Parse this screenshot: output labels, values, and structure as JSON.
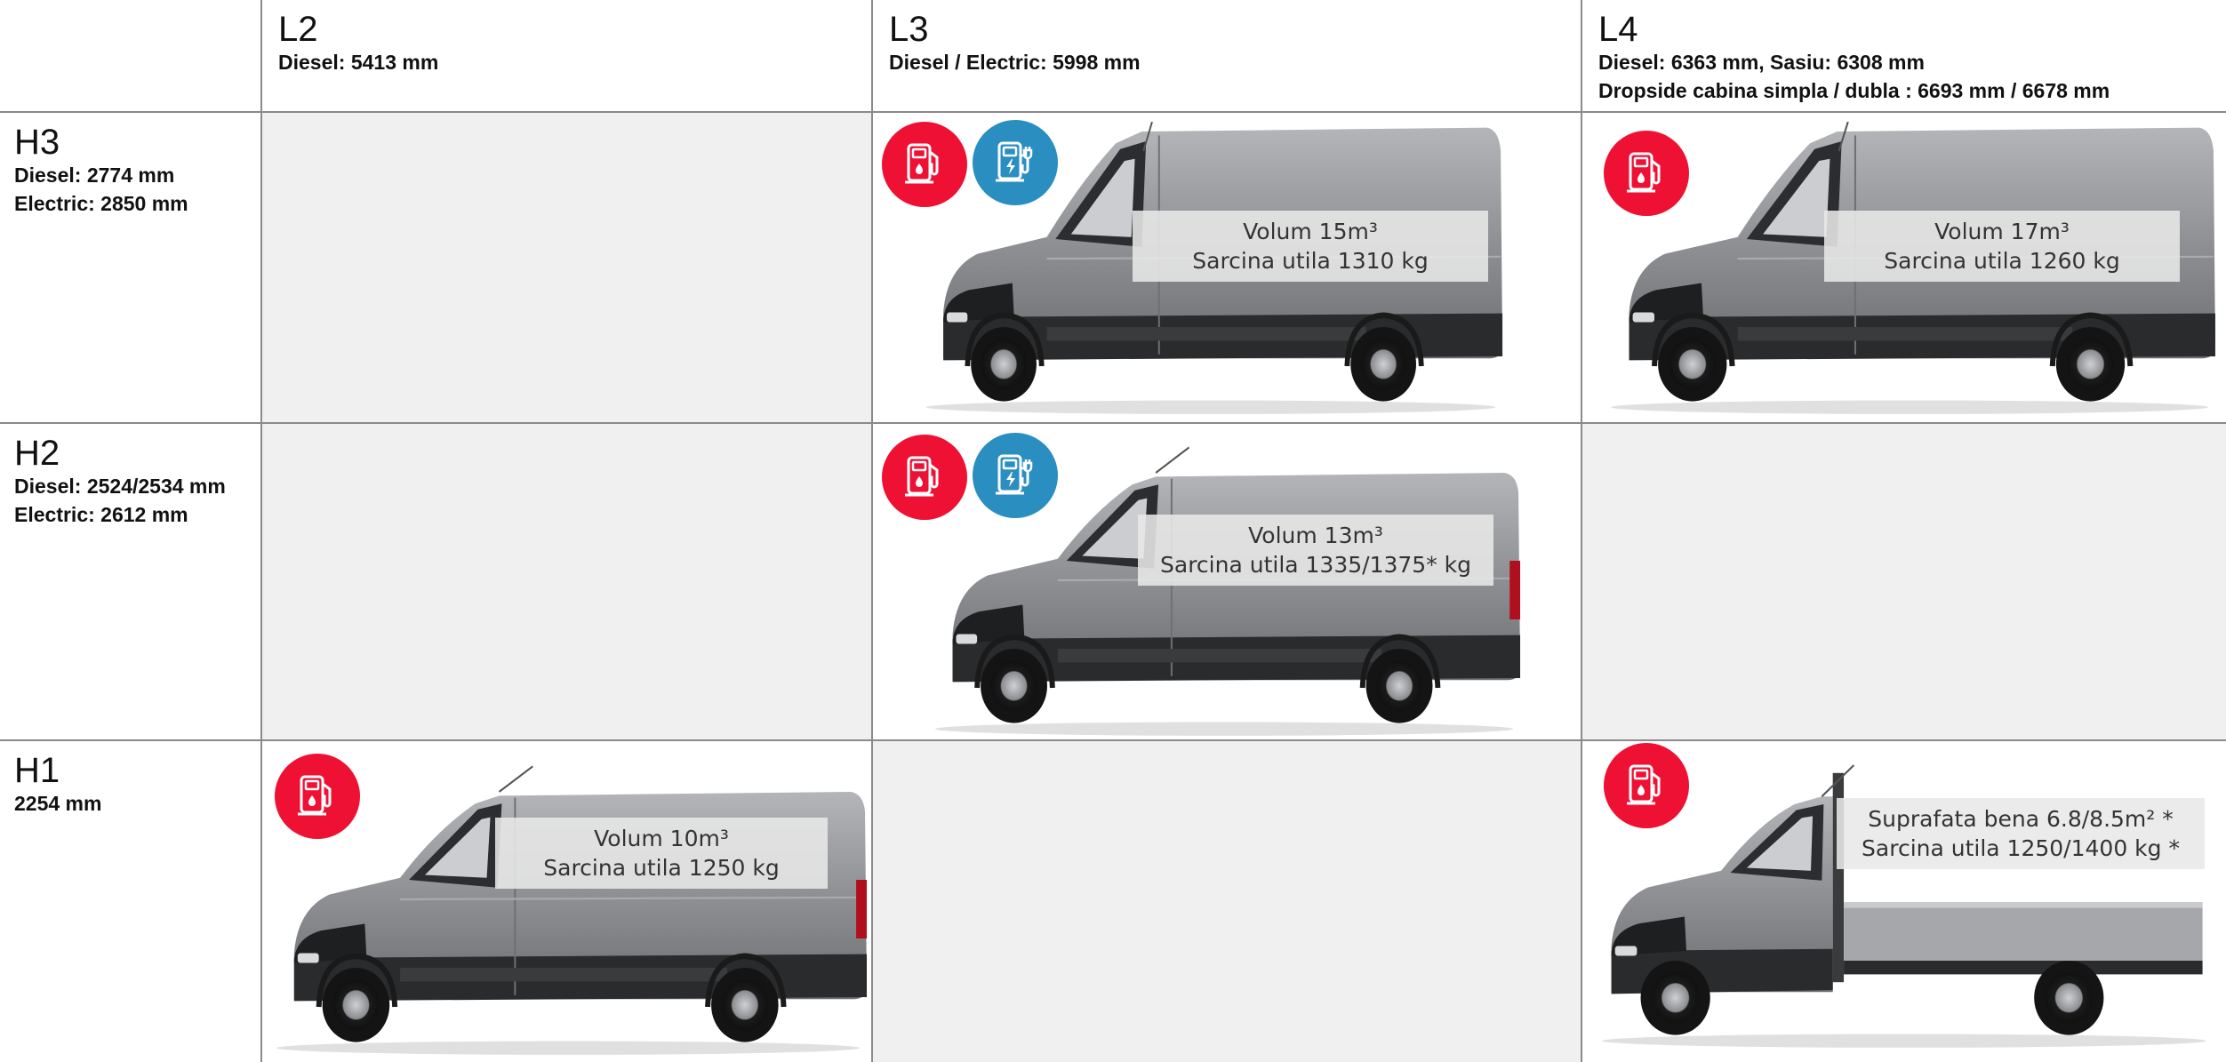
{
  "columns": [
    {
      "title": "L2",
      "lines": [
        "Diesel: 5413 mm"
      ]
    },
    {
      "title": "L3",
      "lines": [
        "Diesel / Electric: 5998 mm"
      ]
    },
    {
      "title": "L4",
      "lines": [
        "Diesel: 6363 mm, Sasiu: 6308 mm",
        "Dropside cabina simpla / dubla : 6693 mm / 6678 mm"
      ]
    }
  ],
  "rows": [
    {
      "title": "H3",
      "lines": [
        "Diesel: 2774 mm",
        "Electric: 2850 mm"
      ]
    },
    {
      "title": "H2",
      "lines": [
        "Diesel: 2524/2534 mm",
        "Electric: 2612 mm"
      ]
    },
    {
      "title": "H1",
      "lines": [
        "2254 mm"
      ]
    }
  ],
  "cells": {
    "h3_l3": {
      "line1": "Volum 15m³",
      "line2": "Sarcina utila 1310 kg"
    },
    "h3_l4": {
      "line1": "Volum 17m³",
      "line2": "Sarcina utila 1260 kg"
    },
    "h2_l3": {
      "line1": "Volum 13m³",
      "line2": "Sarcina utila 1335/1375* kg"
    },
    "h1_l2": {
      "line1": "Volum 10m³",
      "line2": "Sarcina utila 1250 kg"
    },
    "h1_l4": {
      "line1": "Suprafata bena  6.8/8.5m² *",
      "line2": "Sarcina utila 1250/1400 kg *"
    }
  },
  "icons": {
    "diesel": "fuel-pump-icon",
    "electric": "ev-charger-icon"
  },
  "colors": {
    "diesel_badge": "#ee1133",
    "electric_badge": "#2a8fc0",
    "empty_cell": "#f0f0f0",
    "van_body": "#8c8e92"
  }
}
